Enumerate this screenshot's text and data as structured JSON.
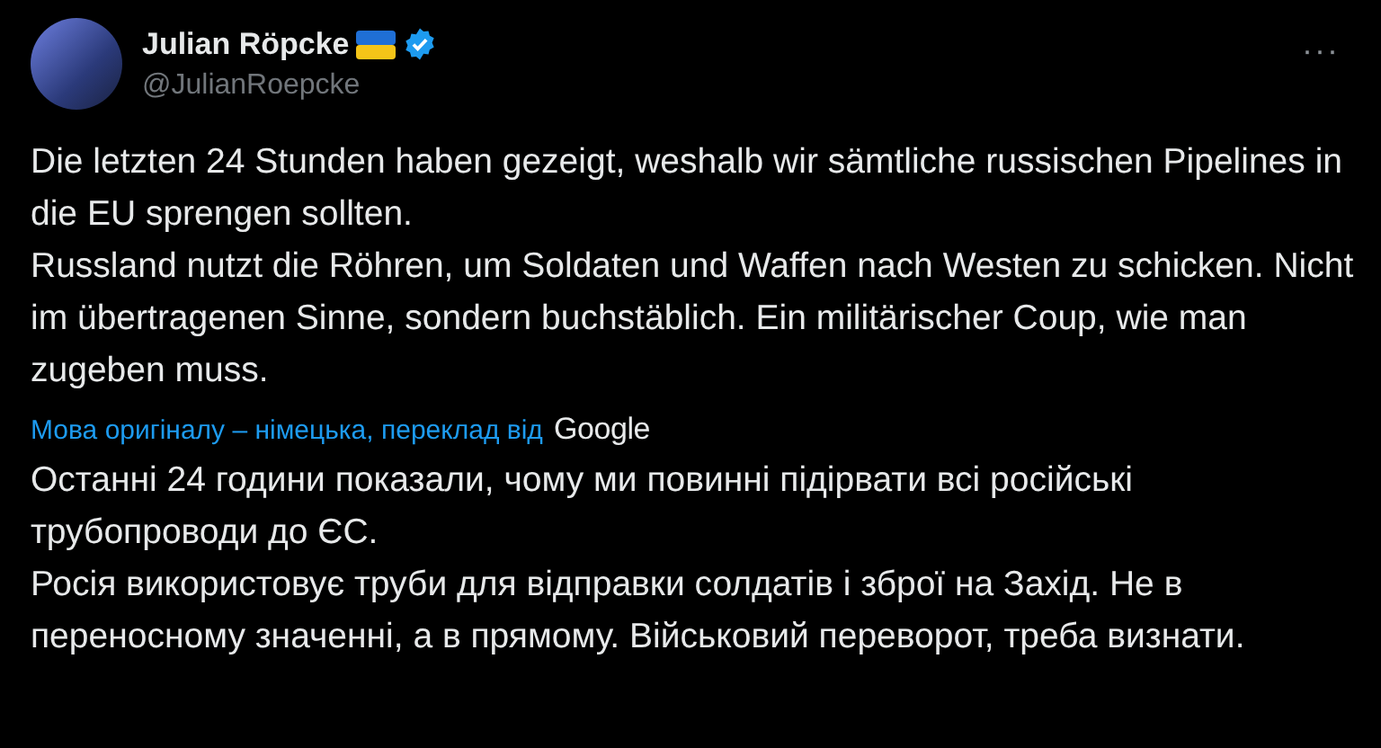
{
  "author": {
    "name": "Julian Röpcke",
    "handle": "@JulianRoepcke",
    "verified": true
  },
  "more_button": {
    "label": "···"
  },
  "post_text": [
    "Die letzten 24 Stunden haben gezeigt, weshalb wir sämtliche russischen Pipelines in die EU sprengen sollten.",
    "Russland nutzt die Röhren, um Soldaten und Waffen nach Westen zu schicken. Nicht im übertragenen Sinne, sondern buchstäblich. Ein militärischer Coup, wie man zugeben muss."
  ],
  "translation": {
    "notice": "Мова оригіналу – німецька, переклад від",
    "provider": "Google",
    "text": [
      "Останні 24 години показали, чому ми повинні підірвати всі російські трубопроводи до ЄС.",
      "Росія використовує труби для відправки солдатів і зброї на Захід. Не в переносному значенні, а в прямому. Військовий переворот, треба визнати."
    ]
  }
}
